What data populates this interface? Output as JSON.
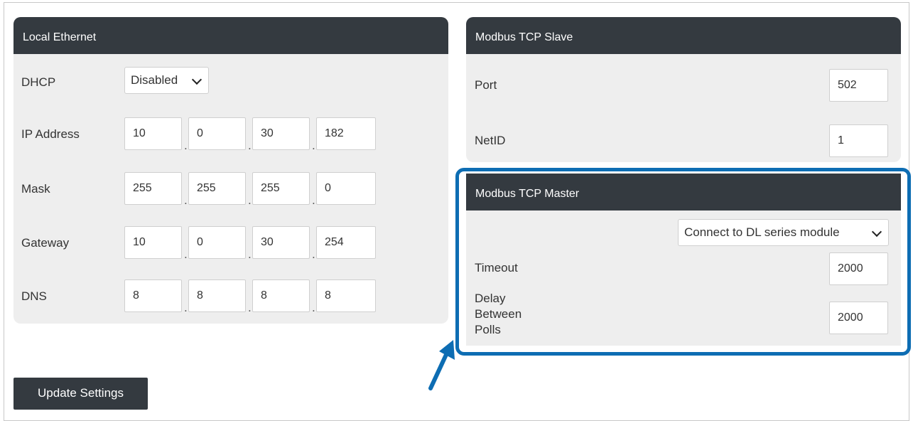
{
  "local_ethernet": {
    "title": "Local Ethernet",
    "dhcp": {
      "label": "DHCP",
      "value": "Disabled"
    },
    "ip_address": {
      "label": "IP Address",
      "octets": [
        "10",
        "0",
        "30",
        "182"
      ]
    },
    "mask": {
      "label": "Mask",
      "octets": [
        "255",
        "255",
        "255",
        "0"
      ]
    },
    "gateway": {
      "label": "Gateway",
      "octets": [
        "10",
        "0",
        "30",
        "254"
      ]
    },
    "dns": {
      "label": "DNS",
      "octets": [
        "8",
        "8",
        "8",
        "8"
      ]
    },
    "separator": "."
  },
  "modbus_slave": {
    "title": "Modbus TCP Slave",
    "port": {
      "label": "Port",
      "value": "502"
    },
    "netid": {
      "label": "NetID",
      "value": "1"
    }
  },
  "modbus_master": {
    "title": "Modbus TCP Master",
    "mode": {
      "value": "Connect to DL series module"
    },
    "timeout": {
      "label": "Timeout",
      "value": "2000"
    },
    "delay": {
      "label_lines": [
        "Delay",
        "Between",
        "Polls"
      ],
      "value": "2000"
    }
  },
  "actions": {
    "update_label": "Update Settings"
  },
  "colors": {
    "header_bg": "#343a40",
    "panel_bg": "#eeeeee",
    "highlight": "#0d6db3"
  }
}
